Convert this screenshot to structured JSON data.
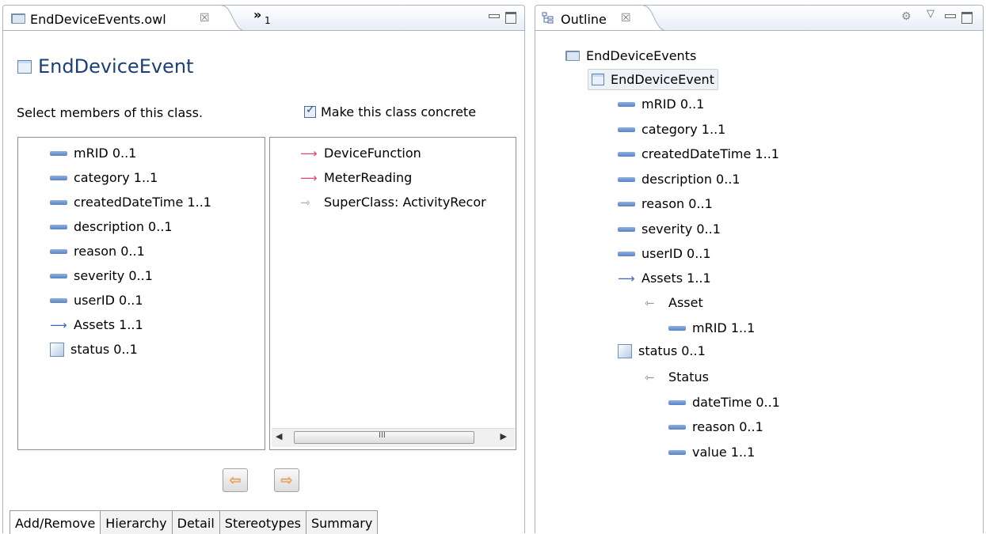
{
  "editor": {
    "tab_title": "EndDeviceEvents.owl",
    "overflow_label": "»",
    "overflow_count": "1",
    "class_title": "EndDeviceEvent",
    "select_label": "Select members of this class.",
    "concrete_label": "Make this class concrete",
    "concrete_checked": true,
    "members": [
      {
        "icon": "attribute-icon",
        "label": "mRID 0..1"
      },
      {
        "icon": "attribute-icon",
        "label": "category 1..1"
      },
      {
        "icon": "attribute-icon",
        "label": "createdDateTime 1..1"
      },
      {
        "icon": "attribute-icon",
        "label": "description 0..1"
      },
      {
        "icon": "attribute-icon",
        "label": "reason 0..1"
      },
      {
        "icon": "attribute-icon",
        "label": "severity 0..1"
      },
      {
        "icon": "attribute-icon",
        "label": "userID 0..1"
      },
      {
        "icon": "association-arrow-icon",
        "label": "Assets 1..1"
      },
      {
        "icon": "enumeration-icon",
        "label": "status 0..1"
      }
    ],
    "available": [
      {
        "icon": "association-arrow-icon",
        "label": "DeviceFunction"
      },
      {
        "icon": "association-arrow-icon",
        "label": "MeterReading"
      },
      {
        "icon": "superclass-arrow-icon",
        "label": "SuperClass: ActivityRecor"
      }
    ],
    "scroll_grip": "III",
    "bottom_tabs": [
      "Add/Remove",
      "Hierarchy",
      "Detail",
      "Stereotypes",
      "Summary"
    ],
    "active_tab": "Add/Remove"
  },
  "outline": {
    "tab_title": "Outline",
    "tree": [
      {
        "icon": "folder-icon",
        "label": "EndDeviceEvents",
        "level": 0
      },
      {
        "icon": "class-icon",
        "label": "EndDeviceEvent",
        "level": 1,
        "selected": true
      },
      {
        "icon": "attribute-icon",
        "label": "mRID 0..1",
        "level": 2
      },
      {
        "icon": "attribute-icon",
        "label": "category 1..1",
        "level": 2
      },
      {
        "icon": "attribute-icon",
        "label": "createdDateTime 1..1",
        "level": 2
      },
      {
        "icon": "attribute-icon",
        "label": "description 0..1",
        "level": 2
      },
      {
        "icon": "attribute-icon",
        "label": "reason 0..1",
        "level": 2
      },
      {
        "icon": "attribute-icon",
        "label": "severity 0..1",
        "level": 2
      },
      {
        "icon": "attribute-icon",
        "label": "userID 0..1",
        "level": 2
      },
      {
        "icon": "association-arrow-icon",
        "label": "Assets 1..1",
        "level": 2
      },
      {
        "icon": "inverse-arrow-icon",
        "label": "Asset",
        "level": 3
      },
      {
        "icon": "attribute-icon",
        "label": "mRID 1..1",
        "level": 4
      },
      {
        "icon": "enumeration-icon",
        "label": "status 0..1",
        "level": 2
      },
      {
        "icon": "inverse-arrow-icon",
        "label": "Status",
        "level": 3
      },
      {
        "icon": "attribute-icon",
        "label": "dateTime 0..1",
        "level": 4
      },
      {
        "icon": "attribute-icon",
        "label": "reason 0..1",
        "level": 4
      },
      {
        "icon": "attribute-icon",
        "label": "value 1..1",
        "level": 4
      }
    ]
  }
}
